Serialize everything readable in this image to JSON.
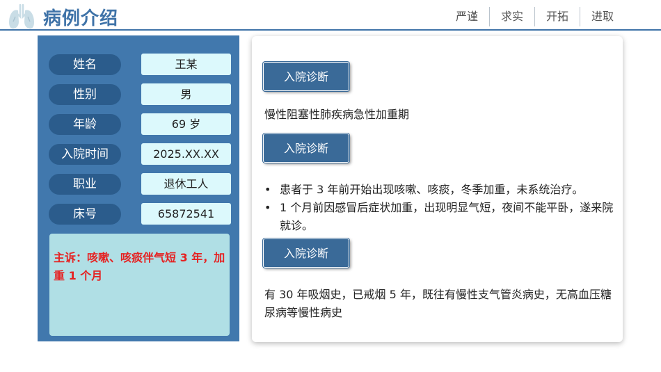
{
  "header": {
    "title": "病例介绍",
    "nav": [
      "严谨",
      "求实",
      "开拓",
      "进取"
    ]
  },
  "patient": {
    "fields": [
      {
        "label": "姓名",
        "value": "王某"
      },
      {
        "label": "性别",
        "value": "男"
      },
      {
        "label": "年龄",
        "value": "69 岁"
      },
      {
        "label": "入院时间",
        "value": "2025.XX.XX"
      },
      {
        "label": "职业",
        "value": "退休工人"
      },
      {
        "label": "床号",
        "value": "65872541"
      }
    ],
    "complaint": "主诉：咳嗽、咳痰伴气短 3 年，加重 1 个月"
  },
  "sections": [
    {
      "button": "入院诊断",
      "text": "慢性阻塞性肺疾病急性加重期"
    },
    {
      "button": "入院诊断",
      "bullets": [
        "患者于 3 年前开始出现咳嗽、咳痰，冬季加重，未系统治疗。",
        "1 个月前因感冒后症状加重，出现明显气短，夜间不能平卧，遂来院就诊。"
      ]
    },
    {
      "button": "入院诊断",
      "text": "有 30 年吸烟史，已戒烟 5 年，既往有慢性支气管炎病史，无高血压糖尿病等慢性病史"
    }
  ],
  "colors": {
    "primary": "#3f73a8",
    "label_bg": "#2b5c8c",
    "value_bg": "#dcf9fc",
    "complaint_bg": "#b0dfe5",
    "complaint_text": "#e52222",
    "button_bg": "#3a6a98"
  },
  "icons": {
    "logo": "lungs-icon"
  }
}
